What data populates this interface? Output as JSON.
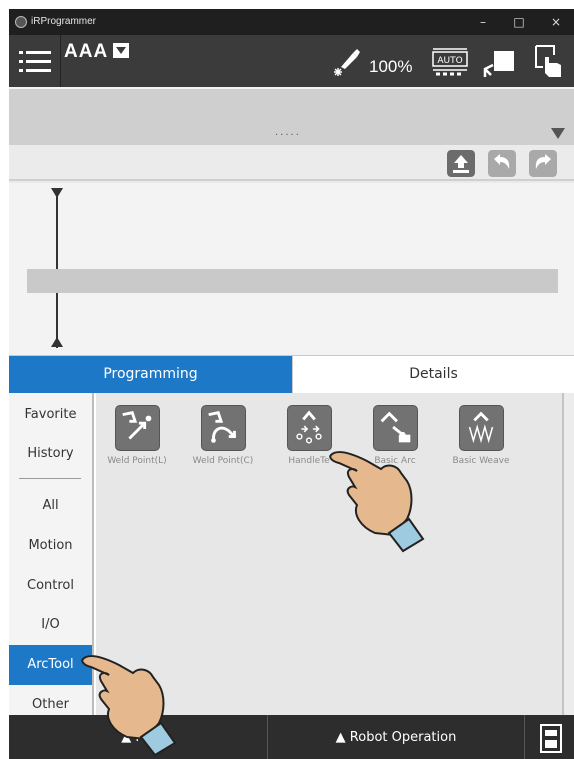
{
  "window": {
    "title": "iRProgrammer",
    "controls": [
      "–",
      "□",
      "×"
    ]
  },
  "topbar": {
    "program_name": "AAA",
    "override": "100%",
    "mode_label": "AUTO"
  },
  "ribbon": {
    "dots": "....."
  },
  "tabs": [
    {
      "label": "Programming",
      "active": true
    },
    {
      "label": "Details",
      "active": false
    }
  ],
  "categories": [
    {
      "label": "Favorite"
    },
    {
      "label": "History"
    },
    {
      "label": "All"
    },
    {
      "label": "Motion"
    },
    {
      "label": "Control"
    },
    {
      "label": "I/O"
    },
    {
      "label": "ArcTool",
      "active": true
    },
    {
      "label": "Other"
    }
  ],
  "palette": [
    {
      "label": "Weld Point(L)",
      "icon": "weld-point-linear-icon"
    },
    {
      "label": "Weld Point(C)",
      "icon": "weld-point-circular-icon"
    },
    {
      "label": "HandleTe",
      "icon": "handle-teach-icon"
    },
    {
      "label": "Basic Arc",
      "icon": "basic-arc-icon"
    },
    {
      "label": "Basic Weave",
      "icon": "basic-weave-icon"
    }
  ],
  "bottombar": {
    "play_label": "▲ Pla",
    "robot_operation_label": "▲ Robot Operation"
  },
  "colors": {
    "accent": "#1e78c8",
    "topbar": "#3b3b3b",
    "bottombar": "#2d2d2d"
  }
}
